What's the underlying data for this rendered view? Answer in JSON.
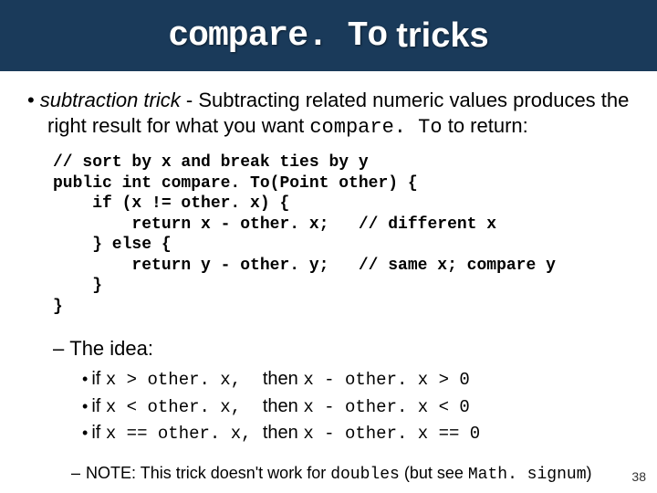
{
  "title": {
    "mono": "compare. To",
    "rest": "tricks"
  },
  "bullet1": {
    "dot": "•",
    "term": "subtraction trick",
    "dash": " - ",
    "text1": "Subtracting related numeric values produces the right result for what you want ",
    "code": "compare. To",
    "text2": " to return:"
  },
  "code": {
    "l1": "// sort by x and break ties by y",
    "l2": "public int compare. To(Point other) {",
    "l3": "    if (x != other. x) {",
    "l4": "        return x - other. x;   // different x",
    "l5": "    } else {",
    "l6": "        return y - other. y;   // same x; compare y",
    "l7": "    }",
    "l8": "}"
  },
  "idea": {
    "dash": "–",
    "label": "The idea:",
    "rows": [
      {
        "dot": "•",
        "if_word": "if ",
        "cond": "x > other. x,",
        "then_word": "then ",
        "res": "x - other. x > 0"
      },
      {
        "dot": "•",
        "if_word": "if ",
        "cond": "x < other. x,",
        "then_word": "then ",
        "res": "x - other. x < 0"
      },
      {
        "dot": "•",
        "if_word": "if ",
        "cond": "x == other. x,",
        "then_word": "then ",
        "res": "x - other. x == 0"
      }
    ]
  },
  "note": {
    "dash": "–",
    "label": "NOTE: ",
    "text1": "This trick doesn't work for ",
    "code1": "doubles",
    "text2": "  (but see ",
    "code2": "Math. signum",
    "text3": ")"
  },
  "page_number": "38"
}
